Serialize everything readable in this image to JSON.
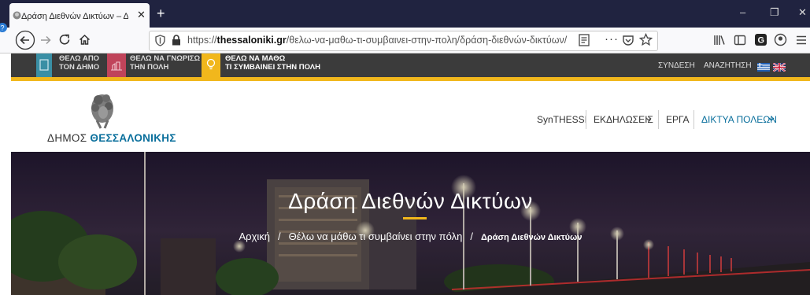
{
  "browser": {
    "tab_title": "Δράση Διεθνών Δικτύων – Δήμ",
    "tab_close": "✕",
    "new_tab": "+",
    "url_prefix": "https://",
    "url_domain": "thessaloniki.gr",
    "url_path": "/θελω-να-μαθω-τι-συμβαινει-στην-πολη/δράση-διεθνών-δικτύων/",
    "icons": [
      "back-icon",
      "forward-icon",
      "reload-icon",
      "home-icon",
      "shield-icon",
      "lock-icon",
      "reader-icon",
      "more-icon",
      "pocket-icon",
      "bookmark-star-icon",
      "library-icon",
      "sidebar-icon",
      "extension-icon",
      "account-icon",
      "menu-icon"
    ],
    "window_controls": [
      "–",
      "❐",
      "✕"
    ]
  },
  "site_strip": {
    "items": [
      {
        "line1": "ΘΕΛΩ ΑΠΟ",
        "line2": "ΤΟΝ ΔΗΜΟ",
        "color": "#3a8fa5"
      },
      {
        "line1": "ΘΕΛΩ ΝΑ ΓΝΩΡΙΣΩ",
        "line2": "ΤΗΝ ΠΟΛΗ",
        "color": "#c0445a"
      },
      {
        "line1": "ΘΕΛΩ ΝΑ ΜΑΘΩ",
        "line2": "ΤΙ ΣΥΜΒΑΙΝΕΙ ΣΤΗΝ ΠΟΛΗ",
        "color": "#f1b71c"
      }
    ],
    "login": "ΣΥΝΔΕΣΗ",
    "search": "ΑΝΑΖΗΤΗΣΗ"
  },
  "logo": {
    "prefix": "ΔΗΜΟΣ ",
    "name": "ΘΕΣΣΑΛΟΝΙΚΗΣ"
  },
  "menu": {
    "items": [
      {
        "label": "SynTHESSI",
        "dropdown": false
      },
      {
        "label": "ΕΚΔΗΛΩΣΕΙΣ",
        "dropdown": true
      },
      {
        "label": "ΕΡΓΑ",
        "dropdown": false
      },
      {
        "label": "ΔΙΚΤΥΑ ΠΟΛΕΩΝ",
        "dropdown": true
      }
    ],
    "active_color": "#0a6f9c"
  },
  "hero": {
    "title": "Δράση Διεθνών Δικτύων",
    "breadcrumb": [
      "Αρχική",
      "Θέλω να μάθω τι συμβαίνει στην πόλη",
      "Δράση Διεθνών Δικτύων"
    ],
    "separator": "/"
  },
  "colors": {
    "accent": "#f1b71c",
    "brand_blue": "#0a6f9c",
    "strip_bg": "#3b3b3b",
    "browser_dark": "#202340"
  }
}
